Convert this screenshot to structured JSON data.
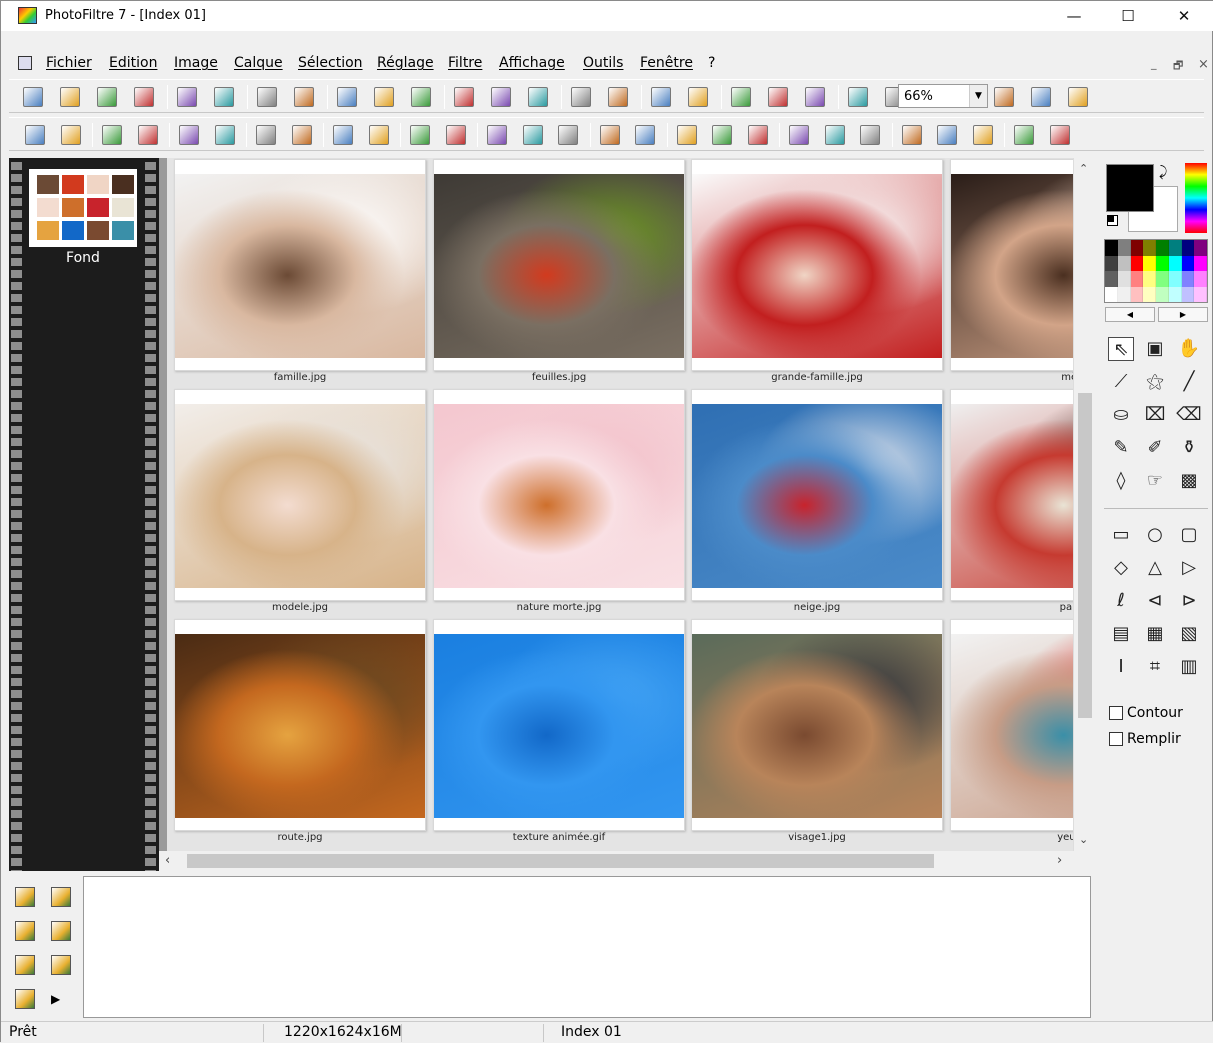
{
  "window": {
    "title": "PhotoFiltre 7 - [Index 01]",
    "minimize": "—",
    "maximize": "☐",
    "close": "✕"
  },
  "menu": {
    "items": [
      "Fichier",
      "Edition",
      "Image",
      "Calque",
      "Sélection",
      "Réglage",
      "Filtre",
      "Affichage",
      "Outils",
      "Fenêtre",
      "?"
    ],
    "mdi": {
      "minimize": "_",
      "restore": "🗗",
      "close": "×"
    }
  },
  "toolbar": {
    "zoom_value": "66%",
    "main_icons": [
      "new-icon",
      "open-icon",
      "save-icon",
      "save-as-icon",
      "print-icon",
      "scan-icon",
      "undo-icon",
      "redo-icon",
      "copy-icon",
      "paste-icon",
      "paste-new-icon",
      "fill-icon",
      "mosaic-icon",
      "transparency-icon",
      "selection-icon",
      "crop-icon",
      "select-all-icon",
      "text-icon",
      "layer-icon",
      "effects-icon",
      "browser-icon",
      "zoom-in-icon",
      "zoom-out-icon",
      "fit-icon",
      "actual-size-icon",
      "fullscreen-icon"
    ],
    "adjust_icons": [
      "brightness-plus-icon",
      "brightness-minus-icon",
      "contrast-plus-icon",
      "contrast-minus-icon",
      "gamma-plus-icon",
      "gamma-minus-icon",
      "saturation-plus-icon",
      "saturation-minus-icon",
      "levels-icon",
      "equalize-icon",
      "auto-gamma-icon",
      "auto-contrast-icon",
      "grid-icon",
      "mosaic-icon",
      "pixel-icon",
      "blur-icon",
      "sharpen-icon",
      "sharpen-more-icon",
      "emboss-icon",
      "relief-icon",
      "drop-icon",
      "spectrum-icon",
      "monitor-icon",
      "wand-icon",
      "mirror-icon",
      "flip-icon",
      "rotate-icon",
      "rotate-back-icon"
    ]
  },
  "layers": {
    "items": [
      {
        "label": "Fond"
      }
    ]
  },
  "gallery": {
    "rows": [
      [
        {
          "caption": "famille.jpg",
          "colors": [
            "#f2f2f2",
            "#d9b8a0",
            "#6b4a35",
            "#ffffff"
          ]
        },
        {
          "caption": "feuilles.jpg",
          "colors": [
            "#3e3a35",
            "#7a6f62",
            "#d23a1e",
            "#6c9a1e"
          ]
        },
        {
          "caption": "grande-famille.jpg",
          "colors": [
            "#fafafa",
            "#c21f1f",
            "#f0d5c5",
            "#fafafa"
          ]
        },
        {
          "caption": "mère-",
          "colors": [
            "#2a1d18",
            "#d2a488",
            "#4a2f20",
            "#e9cfc0"
          ]
        }
      ],
      [
        {
          "caption": "modele.jpg",
          "colors": [
            "#f2eeea",
            "#d7b389",
            "#f3dcd0",
            "#e8e4e0"
          ]
        },
        {
          "caption": "nature morte.jpg",
          "colors": [
            "#f4c7cf",
            "#f9e0e4",
            "#ce6f2b",
            "#f2c1ca"
          ]
        },
        {
          "caption": "neige.jpg",
          "colors": [
            "#2f6fb3",
            "#4b8bc9",
            "#c8232c",
            "#e6e8ee"
          ]
        },
        {
          "caption": "parroq",
          "colors": [
            "#efefef",
            "#c63a30",
            "#e9e4d5",
            "#3a2a25"
          ]
        }
      ],
      [
        {
          "caption": "route.jpg",
          "colors": [
            "#4a2b14",
            "#c4681f",
            "#e5a340",
            "#6b4a22"
          ]
        },
        {
          "caption": "texture animée.gif",
          "colors": [
            "#1a7fe0",
            "#3296f0",
            "#1268c8",
            "#45a5f5"
          ]
        },
        {
          "caption": "visage1.jpg",
          "colors": [
            "#5a6b5a",
            "#b8845a",
            "#7a4a30",
            "#2c2f38"
          ]
        },
        {
          "caption": "yeux ro",
          "colors": [
            "#f2f2f2",
            "#c79c86",
            "#3a8fa8",
            "#e21f1f"
          ]
        }
      ]
    ]
  },
  "tools": {
    "options": {
      "outline": "Contour",
      "fill": "Remplir"
    },
    "icons": [
      "pointer-icon",
      "frame-icon",
      "hand-icon",
      "eyedropper-icon",
      "magic-wand-icon",
      "line-icon",
      "fill-bucket-icon",
      "spray-icon",
      "eraser-icon",
      "brush-icon",
      "advanced-brush-icon",
      "stamp-icon",
      "blur-drop-icon",
      "finger-icon",
      "portrait-icon",
      "rectangle-icon",
      "ellipse-icon",
      "rounded-rect-icon",
      "diamond-icon",
      "triangle-icon",
      "right-triangle-icon",
      "lasso-icon",
      "polygon-lasso-icon",
      "load-shape-icon",
      "ratio-free-icon",
      "ratio-4-3-icon",
      "ratio-3-2-icon",
      "text-select-icon",
      "crop-marks-icon",
      "window-icon"
    ]
  },
  "palette": {
    "colors": [
      "#000000",
      "#7f7f7f",
      "#7f0000",
      "#7f7f00",
      "#007f00",
      "#007f7f",
      "#00007f",
      "#7f007f",
      "#404040",
      "#c0c0c0",
      "#ff0000",
      "#ffff00",
      "#00ff00",
      "#00ffff",
      "#0000ff",
      "#ff00ff",
      "#606060",
      "#e0e0e0",
      "#ff8080",
      "#ffff80",
      "#80ff80",
      "#80ffff",
      "#8080ff",
      "#ff80ff",
      "#ffffff",
      "#f0f0f0",
      "#ffc0c0",
      "#ffffc0",
      "#c0ffc0",
      "#c0ffff",
      "#c0c0ff",
      "#ffc0ff"
    ],
    "prev": "◀",
    "next": "▶"
  },
  "status": {
    "state": "Prêt",
    "size": "1220x1624x16M",
    "doc": "Index 01"
  }
}
